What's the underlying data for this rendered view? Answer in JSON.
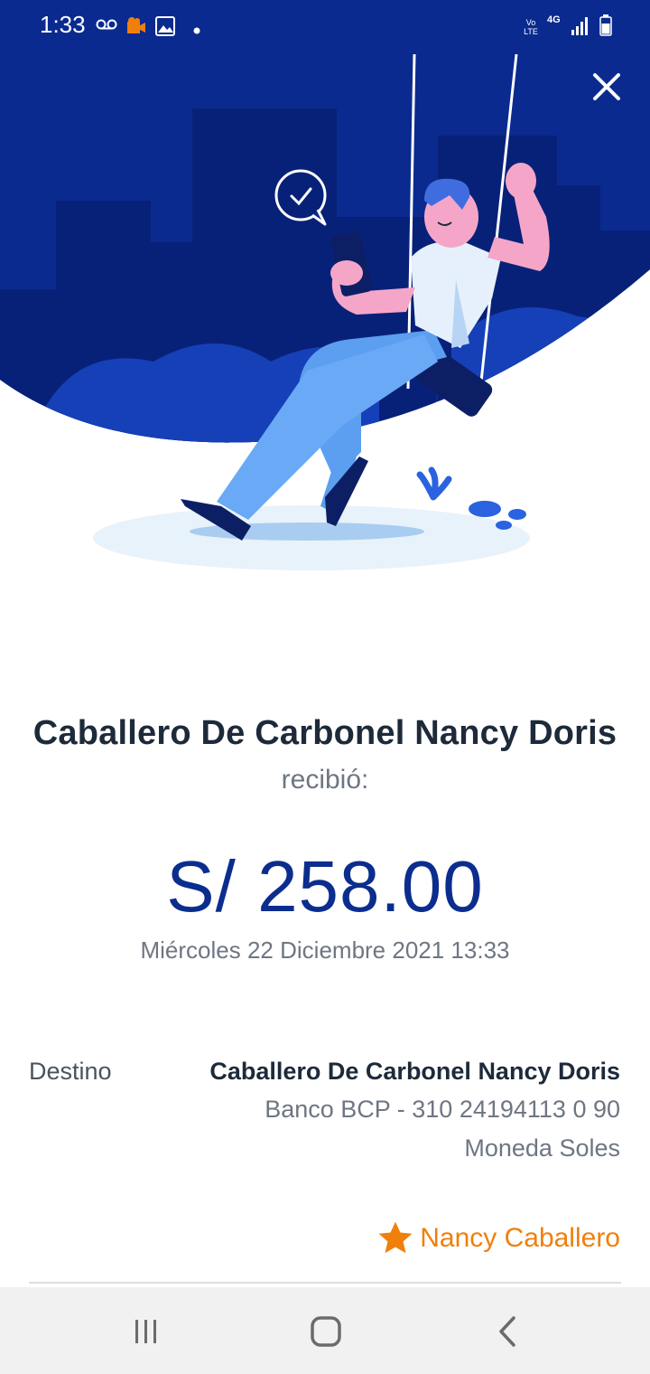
{
  "status_bar": {
    "time": "1:33",
    "icons": [
      "voicemail-icon",
      "video-recorder-icon",
      "gallery-icon",
      "notification-dot-icon",
      "volte-icon",
      "network-4g-icon",
      "signal-icon",
      "battery-icon"
    ],
    "volte_top": "Vo",
    "volte_bottom": "LTE",
    "network": "4G"
  },
  "header": {
    "close_icon": "close-icon"
  },
  "colors": {
    "hero_blue": "#0a2a8f",
    "amount_blue": "#0b2d8e",
    "favorite_orange": "#f07f0b"
  },
  "transfer": {
    "recipient_name": "Caballero De Carbonel Nancy Doris",
    "received_label": "recibió:",
    "amount": "S/ 258.00",
    "date": "Miércoles 22 Diciembre 2021 13:33"
  },
  "details": {
    "destination_label": "Destino",
    "destination_name": "Caballero De Carbonel Nancy Doris",
    "bank_account": "Banco BCP - 310 24194113 0 90",
    "currency": "Moneda Soles"
  },
  "favorite": {
    "icon": "star-icon",
    "label": "Nancy Caballero"
  },
  "nav_bar": {
    "items": [
      "recent-apps-icon",
      "home-icon",
      "back-icon"
    ]
  }
}
